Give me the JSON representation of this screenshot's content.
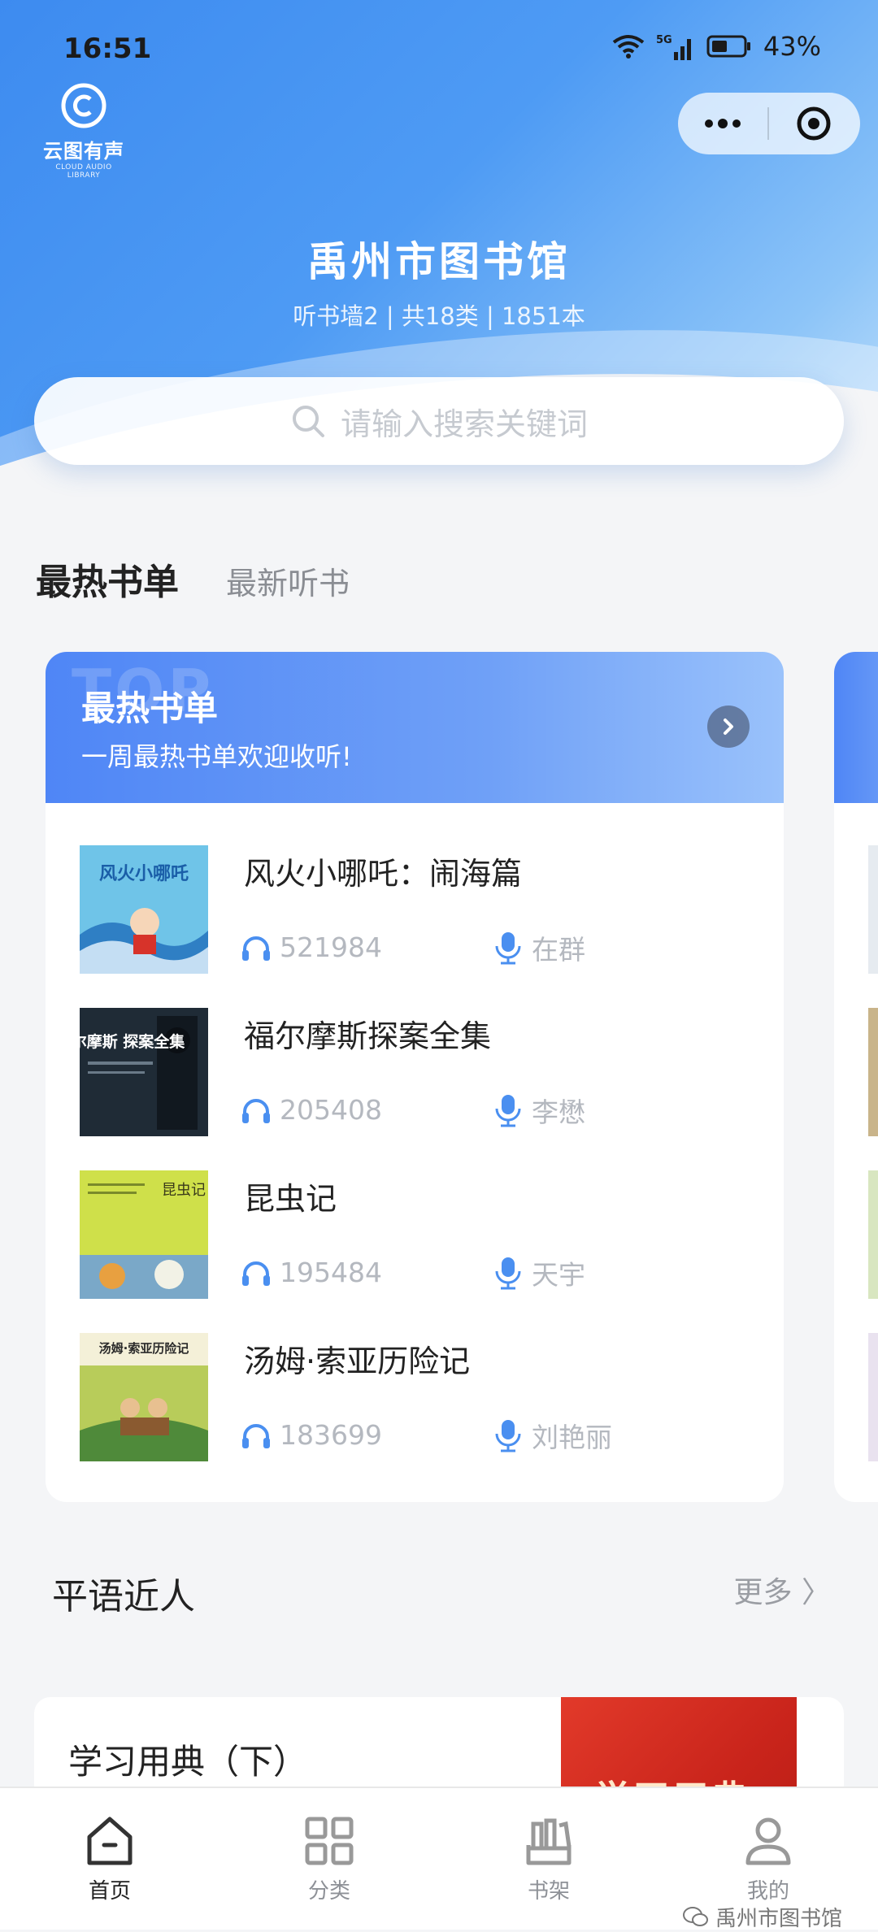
{
  "status_bar": {
    "time": "16:51",
    "network": "5G",
    "battery": "43%"
  },
  "logo": {
    "name": "云图有声",
    "subtitle": "CLOUD AUDIO LIBRARY"
  },
  "header": {
    "library_name": "禹州市图书馆",
    "stats": "听书墙2 | 共18类 | 1851本",
    "search_placeholder": "请输入搜索关键词"
  },
  "tabs": [
    {
      "label": "最热书单",
      "active": true
    },
    {
      "label": "最新听书",
      "active": false
    }
  ],
  "hot_list": {
    "watermark": "TOP",
    "title": "最热书单",
    "subtitle": "一周最热书单欢迎收听!",
    "books": [
      {
        "title": "风火小哪吒：闹海篇",
        "plays": "521984",
        "reader": "在群",
        "cover_text": "风火小哪吒"
      },
      {
        "title": "福尔摩斯探案全集",
        "plays": "205408",
        "reader": "李懋",
        "cover_text": "福尔摩斯 探案全集"
      },
      {
        "title": "昆虫记",
        "plays": "195484",
        "reader": "天宇",
        "cover_text": "昆虫记"
      },
      {
        "title": "汤姆·索亚历险记",
        "plays": "183699",
        "reader": "刘艳丽",
        "cover_text": "汤姆·索亚历险记"
      }
    ]
  },
  "section": {
    "title": "平语近人",
    "more_label": "更多",
    "card_title": "学习用典（下）",
    "card_image_text": "学习用典"
  },
  "bottom_nav": [
    {
      "label": "首页",
      "icon": "home-icon",
      "active": true
    },
    {
      "label": "分类",
      "icon": "grid-icon",
      "active": false
    },
    {
      "label": "书架",
      "icon": "bookshelf-icon",
      "active": false
    },
    {
      "label": "我的",
      "icon": "user-icon",
      "active": false
    }
  ],
  "watermark": "禹州市图书馆",
  "colors": {
    "primary": "#4f86f6",
    "header_blue": "#3d8bf0",
    "icon_blue": "#4a8ff0"
  }
}
